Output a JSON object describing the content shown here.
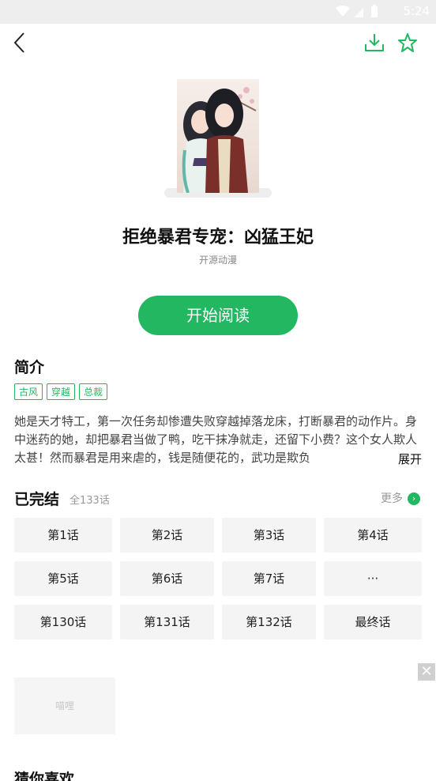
{
  "status": {
    "time": "5:24",
    "icons": [
      "wifi-icon",
      "signal-icon",
      "battery-icon"
    ]
  },
  "topbar": {
    "back_icon": "back-arrow-icon",
    "download_icon": "download-icon",
    "favorite_icon": "star-icon"
  },
  "comic": {
    "title": "拒绝暴君专宠：凶猛王妃",
    "author": "开源动漫"
  },
  "read_button": "开始阅读",
  "intro": {
    "heading": "简介",
    "tags": [
      "古风",
      "穿越",
      "总裁"
    ],
    "description": "她是天才特工，第一次任务却惨遭失败穿越掉落龙床，打断暴君的动作片。身中迷药的她，却把暴君当做了鸭，吃干抹净就走，还留下小费？这个女人欺人太甚！然而暴君是用来虐的，钱是随便花的，武功是欺负",
    "expand": "展开"
  },
  "chapters": {
    "status": "已完结",
    "total": "全133话",
    "more": "更多",
    "items": [
      "第1话",
      "第2话",
      "第3话",
      "第4话",
      "第5话",
      "第6话",
      "第7话",
      "···",
      "第130话",
      "第131话",
      "第132话",
      "最终话"
    ]
  },
  "ad": {
    "placeholder": "喵哩",
    "close": "✕"
  },
  "next_section": "猜你喜欢",
  "colors": {
    "accent": "#22b760",
    "statusbar": "#eeeeee",
    "button_bg": "#f4f4f4"
  }
}
